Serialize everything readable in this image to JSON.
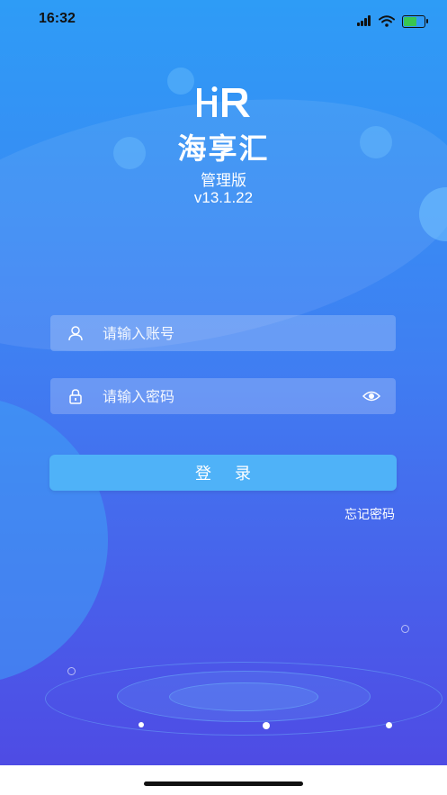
{
  "status_bar": {
    "time": "16:32"
  },
  "branding": {
    "app_name": "海享汇",
    "subtitle": "管理版",
    "version": "v13.1.22"
  },
  "login_form": {
    "account_placeholder": "请输入账号",
    "password_placeholder": "请输入密码",
    "login_label": "登录",
    "forgot_label": "忘记密码"
  },
  "colors": {
    "button": "#4fb2f8",
    "bg_top": "#2e9cf6",
    "bg_bottom": "#4f48e3"
  },
  "icons": {
    "account": "user-icon",
    "password": "lock-icon",
    "show_password": "eye-icon"
  }
}
